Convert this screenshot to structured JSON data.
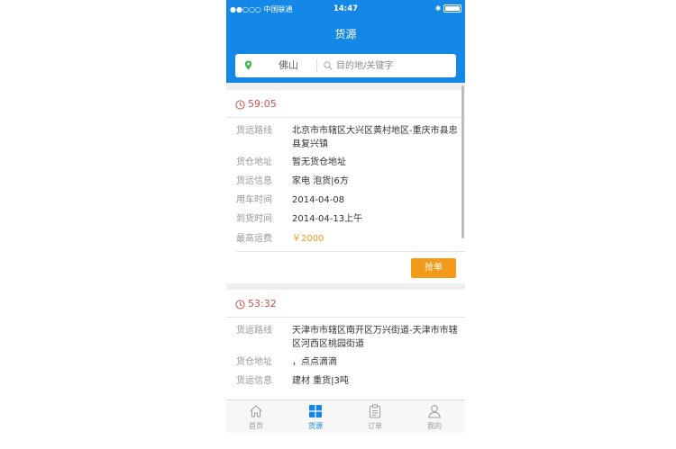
{
  "status_bar": {
    "carrier": "●●○○○ 中国联通",
    "time": "14:47"
  },
  "header": {
    "title": "货源"
  },
  "search": {
    "city": "佛山",
    "placeholder": "目的地/关键字"
  },
  "colors": {
    "primary": "#1587e6",
    "timer": "#d7504a",
    "accent": "#f39a16"
  },
  "cards": [
    {
      "countdown": "59:05",
      "rows": [
        {
          "label": "货运路线",
          "value": "北京市市辖区大兴区黄村地区-重庆市县忠县复兴镇"
        },
        {
          "label": "货仓地址",
          "value": "暂无货仓地址"
        },
        {
          "label": "货运信息",
          "value": "家电 泡货|6方"
        },
        {
          "label": "用车时间",
          "value": "2014-04-08"
        },
        {
          "label": "到货时间",
          "value": "2014-04-13上午"
        },
        {
          "label": "最高运费",
          "value": "￥2000"
        }
      ],
      "action": "抢单"
    },
    {
      "countdown": "53:32",
      "rows": [
        {
          "label": "货运路线",
          "value": "天津市市辖区南开区万兴街道-天津市市辖区河西区桃园街道"
        },
        {
          "label": "货仓地址",
          "value": "，点点滴滴"
        },
        {
          "label": "货运信息",
          "value": "建材 重货|3吨"
        }
      ]
    }
  ],
  "tabs": [
    {
      "label": "首页",
      "icon": "home-icon"
    },
    {
      "label": "货源",
      "icon": "cargo-icon"
    },
    {
      "label": "订单",
      "icon": "clipboard-icon"
    },
    {
      "label": "我的",
      "icon": "user-icon"
    }
  ]
}
